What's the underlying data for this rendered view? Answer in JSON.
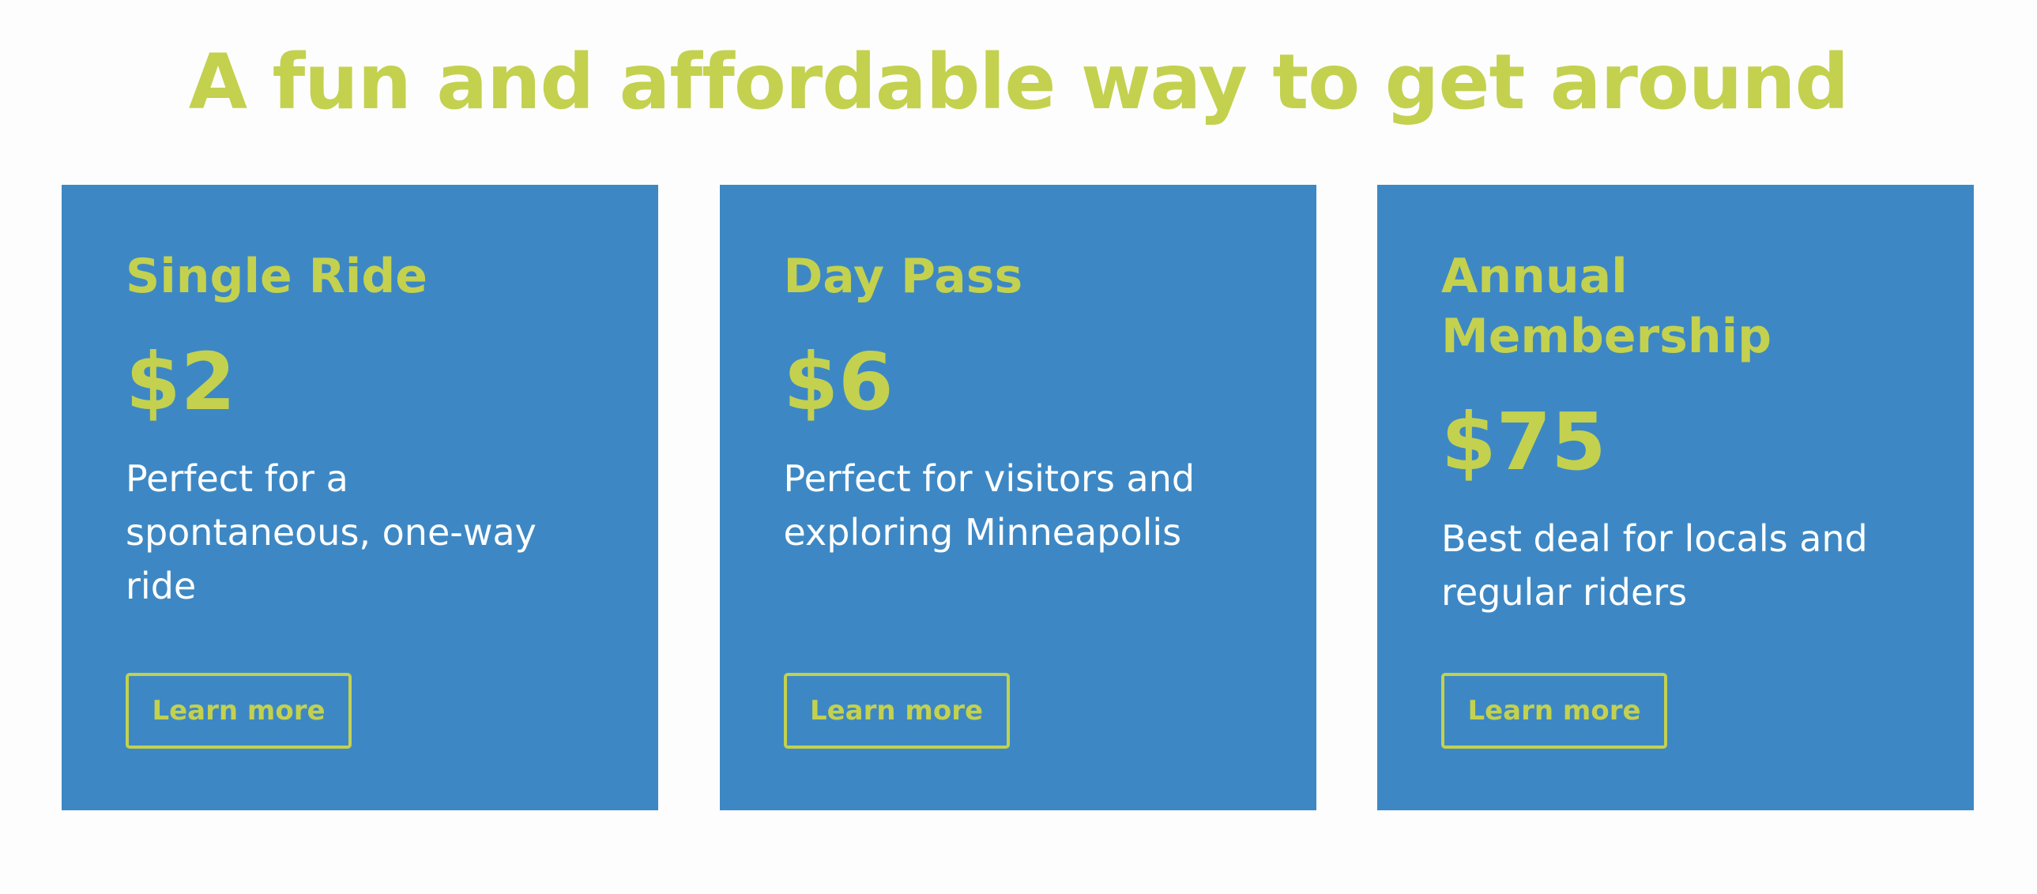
{
  "header": {
    "title": "A fun and affordable way to get around"
  },
  "colors": {
    "accent": "#c3d14f",
    "card_background": "#3d88c4",
    "page_background": "#fdfdfd",
    "body_text": "#ffffff"
  },
  "plans": [
    {
      "name": "Single Ride",
      "price": "$2",
      "description": "Perfect for a spontaneous, one-way ride",
      "button_label": "Learn more"
    },
    {
      "name": "Day Pass",
      "price": "$6",
      "description": "Perfect for visitors and exploring Minneapolis",
      "button_label": "Learn more"
    },
    {
      "name": "Annual Membership",
      "price": "$75",
      "description": "Best deal for locals and regular riders",
      "button_label": "Learn more"
    }
  ]
}
